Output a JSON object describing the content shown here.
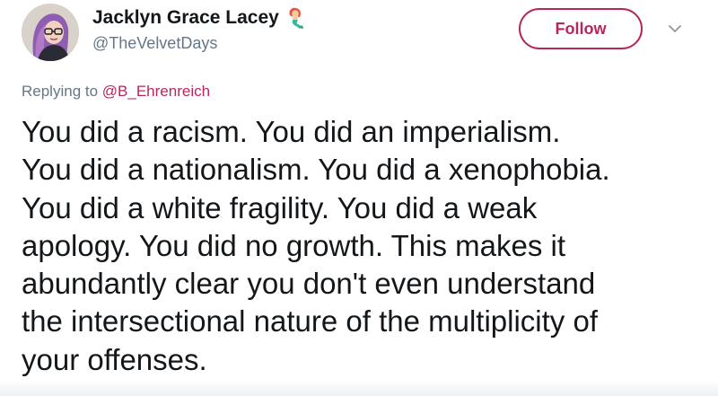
{
  "user": {
    "display_name": "Jacklyn Grace Lacey",
    "handle": "@TheVelvetDays",
    "badge_icon": "mermaid-icon"
  },
  "actions": {
    "follow_label": "Follow",
    "menu_icon": "chevron-down-icon"
  },
  "reply": {
    "prefix": "Replying to",
    "target": "@B_Ehrenreich"
  },
  "tweet": {
    "lines": [
      "You did a racism.  You did an imperialism.",
      "You did a nationalism. You did a xenophobia.",
      "You did a white fragility. You did a weak",
      "apology. You did no growth. This makes it",
      "abundantly clear you don't even understand",
      "the intersectional nature of the multiplicity of",
      "your offenses."
    ]
  },
  "colors": {
    "accent": "#b7275e",
    "text_primary": "#14171a",
    "text_secondary": "#657786"
  }
}
